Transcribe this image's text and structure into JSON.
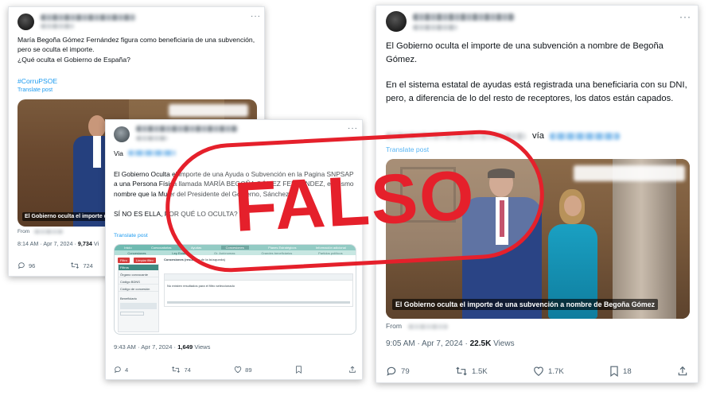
{
  "stamp": {
    "label": "FALSO",
    "color": "#e5202b"
  },
  "tweet_left": {
    "body": "María Begoña Gómez Fernández figura como beneficiaria de una subvención, pero se oculta el importe.\n¿Qué oculta el Gobierno de España?",
    "hashtag": "#CorruPSOE",
    "translate": "Translate post",
    "image_caption": "El Gobierno oculta el importe de",
    "from": "From",
    "time": "8:14 AM · Apr 7, 2024 · ",
    "views_count": "9,734",
    "views_label": " Vi",
    "actions": {
      "replies": "96",
      "reposts": "724"
    }
  },
  "tweet_middle": {
    "via": "Via",
    "body": "El Gobierno Oculta el importe de una Ayuda o Subvención en la Pagina SNPSAP a una Persona Física llamada MARÍA BEGOÑA GÓMEZ FERNANDEZ, el mismo nombre que la Mujer del Presidente del Gobierno, Sánchez.\n\nSÍ NO ES ELLA, POR QUÉ LO OCULTA?",
    "translate": "Translate post",
    "time": "9:43 AM · Apr 7, 2024 · ",
    "views_count": "1,649",
    "views_label": " Views",
    "actions": {
      "replies": "4",
      "reposts": "74",
      "likes": "89"
    },
    "screenshot": {
      "nav": [
        "Inicio",
        "Convocatorias",
        "Ayudas",
        "Concesiones",
        "Planes Estratégicos",
        "Información adicional"
      ],
      "subnav": [
        "Concesiones",
        "Ley Estatal",
        "Gr. Autónomas",
        "Grandes beneficiarios",
        "Partidos políticos"
      ],
      "buttons": [
        "Filtro",
        "Limpiar filtro"
      ],
      "sidebar": [
        "Filtros",
        "Órgano convocante",
        "Código BDNS",
        "Código de concesión",
        "Beneficiario"
      ],
      "heading": "Concesiones (resultado de la búsqueda)",
      "no_results": "No existen resultados para el filtro seleccionado"
    }
  },
  "tweet_right": {
    "para1": "El Gobierno oculta el importe de una subvención a nombre de Begoña Gómez.",
    "para2": "En el sistema estatal de ayudas está registrada una beneficiaria con su DNI, pero, a diferencia de lo del resto de receptores, los datos están capados.",
    "via": "vía",
    "translate": "Translate post",
    "image_caption": "El Gobierno oculta el importe de una subvención a nombre de Begoña Gómez",
    "from": "From",
    "time": "9:05 AM · Apr 7, 2024 · ",
    "views_count": "22.5K",
    "views_label": " Views",
    "actions": {
      "replies": "79",
      "reposts": "1.5K",
      "likes": "1.7K",
      "bookmarks": "18"
    }
  }
}
